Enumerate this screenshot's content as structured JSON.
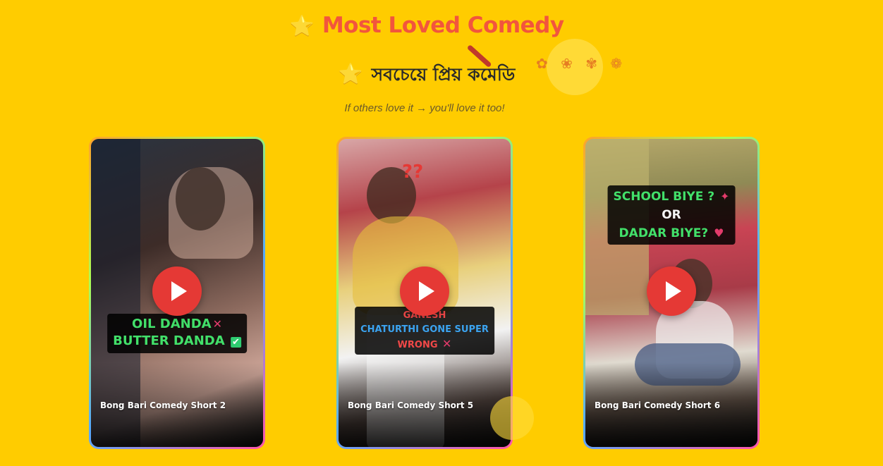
{
  "header": {
    "title_en": "Most Loved Comedy",
    "title_bn": "সবচেয়ে প্রিয় কমেডি",
    "star_icon": "⭐",
    "tagline": "If others love it → you'll love it too!"
  },
  "colors": {
    "background": "#FFCC00",
    "title_accent": "#F2553D",
    "play_button": "#E53935"
  },
  "videos": [
    {
      "title": "Bong Bari Comedy Short 2",
      "overlay_lines": [
        "OIL DANDA",
        "BUTTER DANDA"
      ]
    },
    {
      "title": "Bong Bari Comedy Short 5",
      "overlay_lines": [
        "GANESH",
        "CHATURTHI GONE SUPER",
        "WRONG"
      ]
    },
    {
      "title": "Bong Bari Comedy Short 6",
      "overlay_lines": [
        "SCHOOL BIYE ?",
        "OR",
        "DADAR BIYE?"
      ]
    }
  ]
}
